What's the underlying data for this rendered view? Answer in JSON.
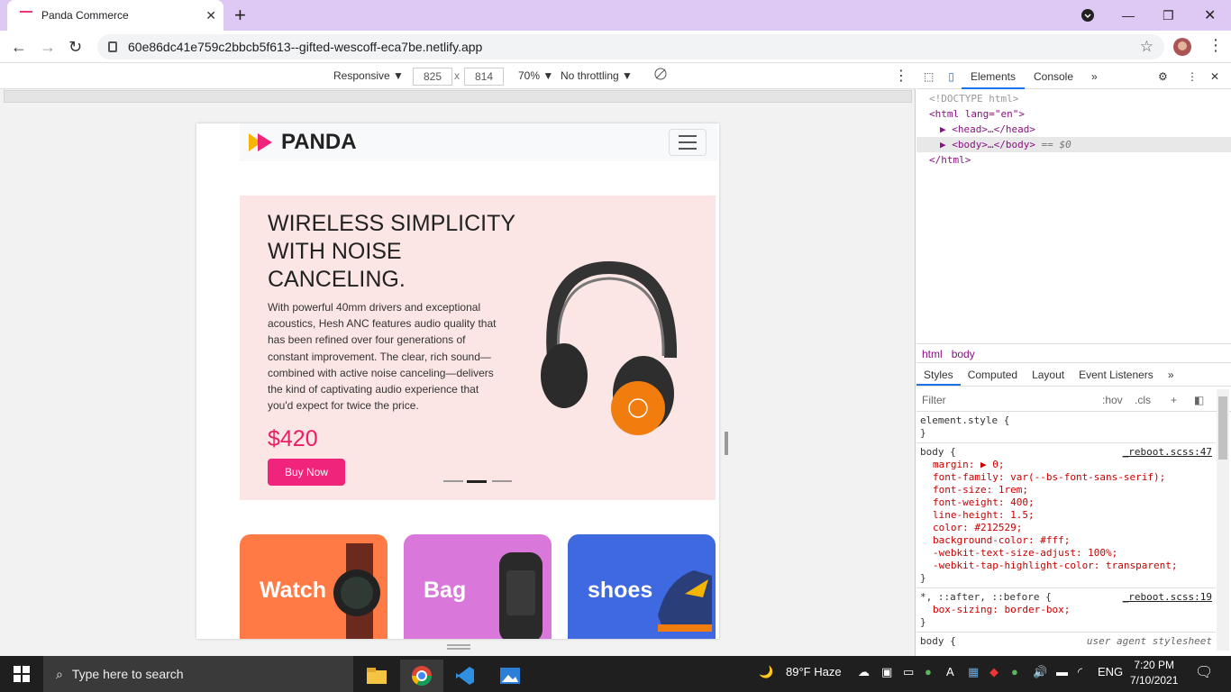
{
  "browser": {
    "tab_title": "Panda Commerce",
    "url": "60e86dc41e759c2bbcb5f613--gifted-wescoff-eca7be.netlify.app"
  },
  "device_toolbar": {
    "mode": "Responsive",
    "width": "825",
    "times": "x",
    "height": "814",
    "zoom": "70%",
    "throttle": "No throttling"
  },
  "page": {
    "brand": "PANDA",
    "hero": {
      "title": "WIRELESS SIMPLICITY WITH NOISE CANCELING.",
      "description": "With powerful 40mm drivers and exceptional acoustics, Hesh ANC features audio quality that has been refined over four generations of constant improvement. The clear, rich sound—combined with active noise canceling—delivers the kind of captivating audio experience that you'd expect for twice the price.",
      "price": "$420",
      "button": "Buy Now"
    },
    "categories": [
      {
        "label": "Watch",
        "color": "#ff7a45"
      },
      {
        "label": "Bag",
        "color": "#d977da"
      },
      {
        "label": "shoes",
        "color": "#3f69e0"
      }
    ]
  },
  "devtools": {
    "tabs": [
      "Elements",
      "Console"
    ],
    "dom": {
      "doctype": "<!DOCTYPE html>",
      "html_open": "<html lang=\"en\">",
      "head": "<head>…</head>",
      "body": "<body>…</body>",
      "body_suffix": "== $0",
      "html_close": "</html>"
    },
    "breadcrumbs": [
      "html",
      "body"
    ],
    "style_tabs": [
      "Styles",
      "Computed",
      "Layout",
      "Event Listeners"
    ],
    "filter_placeholder": "Filter",
    "hov": ":hov",
    "cls": ".cls",
    "element_style": "element.style {",
    "body_rule": {
      "selector": "body {",
      "source": "_reboot.scss:47",
      "props": [
        "margin: ▶ 0;",
        "font-family: var(--bs-font-sans-serif);",
        "font-size: 1rem;",
        "font-weight: 400;",
        "line-height: 1.5;",
        "color: #212529;",
        "background-color: #fff;",
        "-webkit-text-size-adjust: 100%;",
        "-webkit-tap-highlight-color: transparent;"
      ]
    },
    "universal_rule": {
      "selector": "*, ::after, ::before {",
      "source": "_reboot.scss:19",
      "props": [
        "box-sizing: border-box;"
      ]
    },
    "ua_rule": {
      "selector": "body {",
      "source": "user agent stylesheet"
    }
  },
  "taskbar": {
    "search_text": "Type here to search",
    "weather": "89°F  Haze",
    "lang": "ENG",
    "time": "7:20 PM",
    "date": "7/10/2021"
  }
}
